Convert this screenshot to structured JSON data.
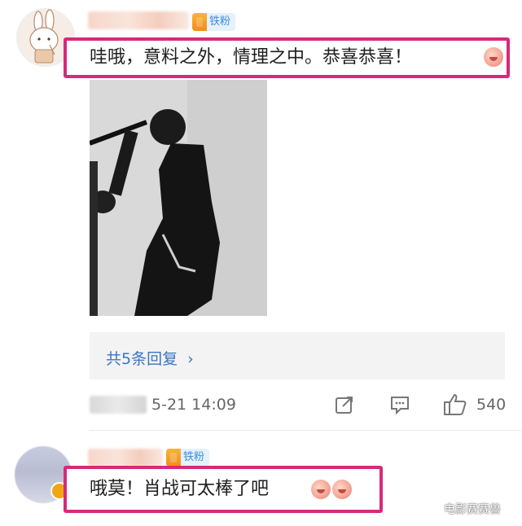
{
  "comment1": {
    "badge": "铁粉",
    "text": "哇哦，意料之外，情理之中。恭喜恭喜！",
    "emoji": "rabbit-emoji"
  },
  "post": {
    "image": "black-and-white-portrait-photo",
    "replies_label": "共5条回复",
    "time": "5-21 14:09",
    "like_count": "540"
  },
  "comment2": {
    "badge": "铁粉",
    "text": "哦莫！肖战可太棒了吧",
    "emoji": "rabbit-emoji"
  },
  "watermark": "电影赛赛兽",
  "colors": {
    "highlight": "#d62a7a",
    "link": "#3a75c4",
    "badge_bg": "#e5f1fb",
    "badge_text": "#3b8ee0"
  }
}
